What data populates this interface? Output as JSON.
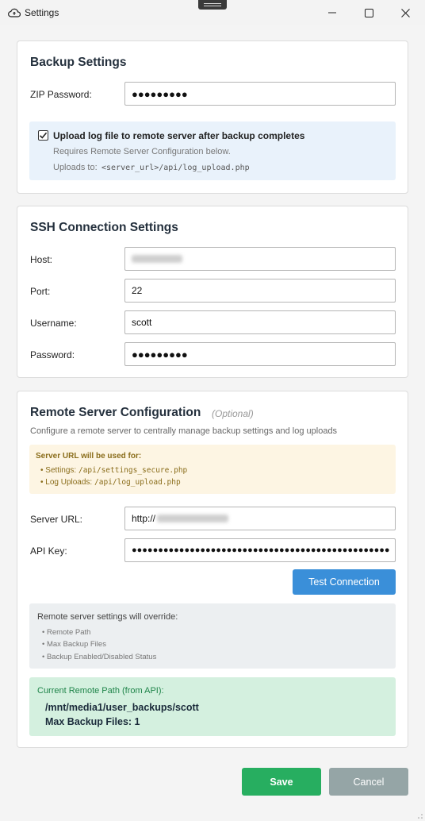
{
  "window": {
    "title": "Settings",
    "minimize_icon": "minimize-icon",
    "maximize_icon": "maximize-icon",
    "close_icon": "close-icon",
    "app_icon": "cloud-upload-icon"
  },
  "backup": {
    "title": "Backup Settings",
    "zip_password_label": "ZIP Password:",
    "zip_password_value": "●●●●●●●●●",
    "upload_log_checked": true,
    "upload_log_label": "Upload log file to remote server after backup completes",
    "upload_log_note": "Requires Remote Server Configuration below.",
    "uploads_to_prefix": "Uploads to:",
    "uploads_to_path": "<server_url>/api/log_upload.php"
  },
  "ssh": {
    "title": "SSH Connection Settings",
    "host_label": "Host:",
    "host_value": "",
    "port_label": "Port:",
    "port_value": "22",
    "username_label": "Username:",
    "username_value": "scott",
    "password_label": "Password:",
    "password_value": "●●●●●●●●●"
  },
  "remote": {
    "title": "Remote Server Configuration",
    "optional_label": "(Optional)",
    "description": "Configure a remote server to centrally manage backup settings and log uploads",
    "urls_heading": "Server URL will be used for:",
    "urls": [
      {
        "label": "Settings:",
        "path": "/api/settings_secure.php"
      },
      {
        "label": "Log Uploads:",
        "path": "/api/log_upload.php"
      }
    ],
    "server_url_label": "Server URL:",
    "server_url_value": "http://",
    "api_key_label": "API Key:",
    "api_key_value": "●●●●●●●●●●●●●●●●●●●●●●●●●●●●●●●●●●●●●●●●●●●●●●●●●",
    "test_button": "Test Connection",
    "override_heading": "Remote server settings will override:",
    "override_items": [
      "Remote Path",
      "Max Backup Files",
      "Backup Enabled/Disabled Status"
    ],
    "current_heading": "Current Remote Path (from API):",
    "current_path": "/mnt/media1/user_backups/scott",
    "max_backup_files": "Max Backup Files: 1"
  },
  "footer": {
    "save_label": "Save",
    "cancel_label": "Cancel"
  },
  "colors": {
    "accent": "#3a8fd9",
    "save": "#27ae60",
    "cancel": "#95a5a6",
    "info_bg": "#e9f2fb",
    "warn_bg": "#fdf5e3",
    "override_bg": "#eceff1",
    "success_bg": "#d4f0df"
  }
}
